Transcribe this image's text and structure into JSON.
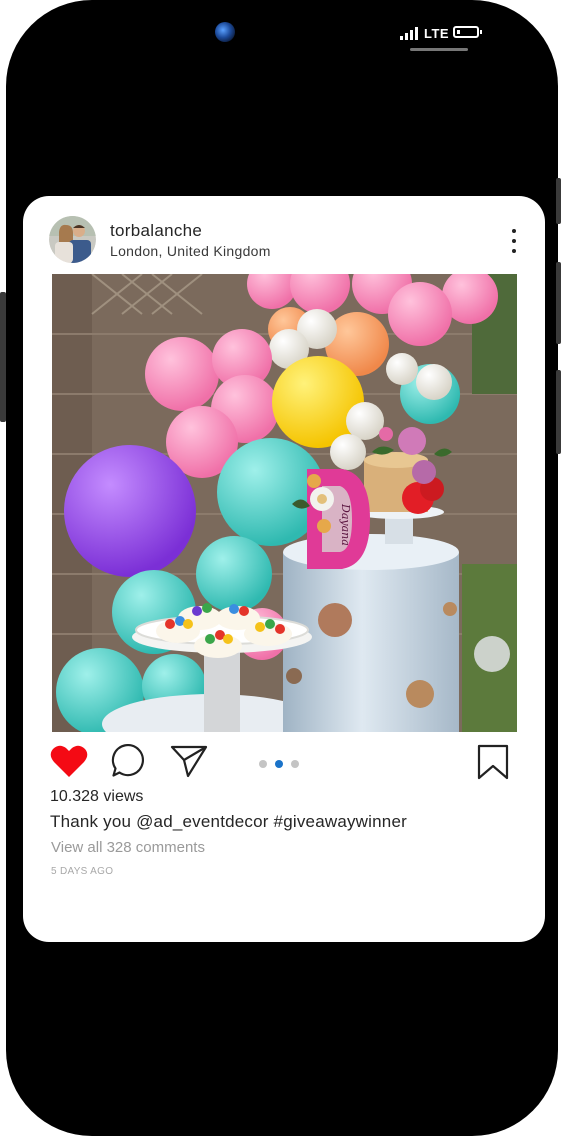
{
  "status_bar": {
    "network": "LTE"
  },
  "post": {
    "username": "torbalanche",
    "location": "London, United Kingdom",
    "views": "10.328 views",
    "caption": "Thank you @ad_eventdecor #giveawaywinner",
    "view_comments": "View all 328 comments",
    "time_ago": "5 DAYS AGO",
    "carousel": {
      "count": 3,
      "active_index": 1
    },
    "photo_text": "Dayana"
  },
  "icons": {
    "like": "heart-icon",
    "comment": "comment-icon",
    "share": "share-icon",
    "save": "bookmark-icon",
    "more": "more-icon"
  },
  "colors": {
    "like": "#f40a14",
    "carousel_active": "#1a73c9",
    "carousel_inactive": "#c4c4c4"
  }
}
